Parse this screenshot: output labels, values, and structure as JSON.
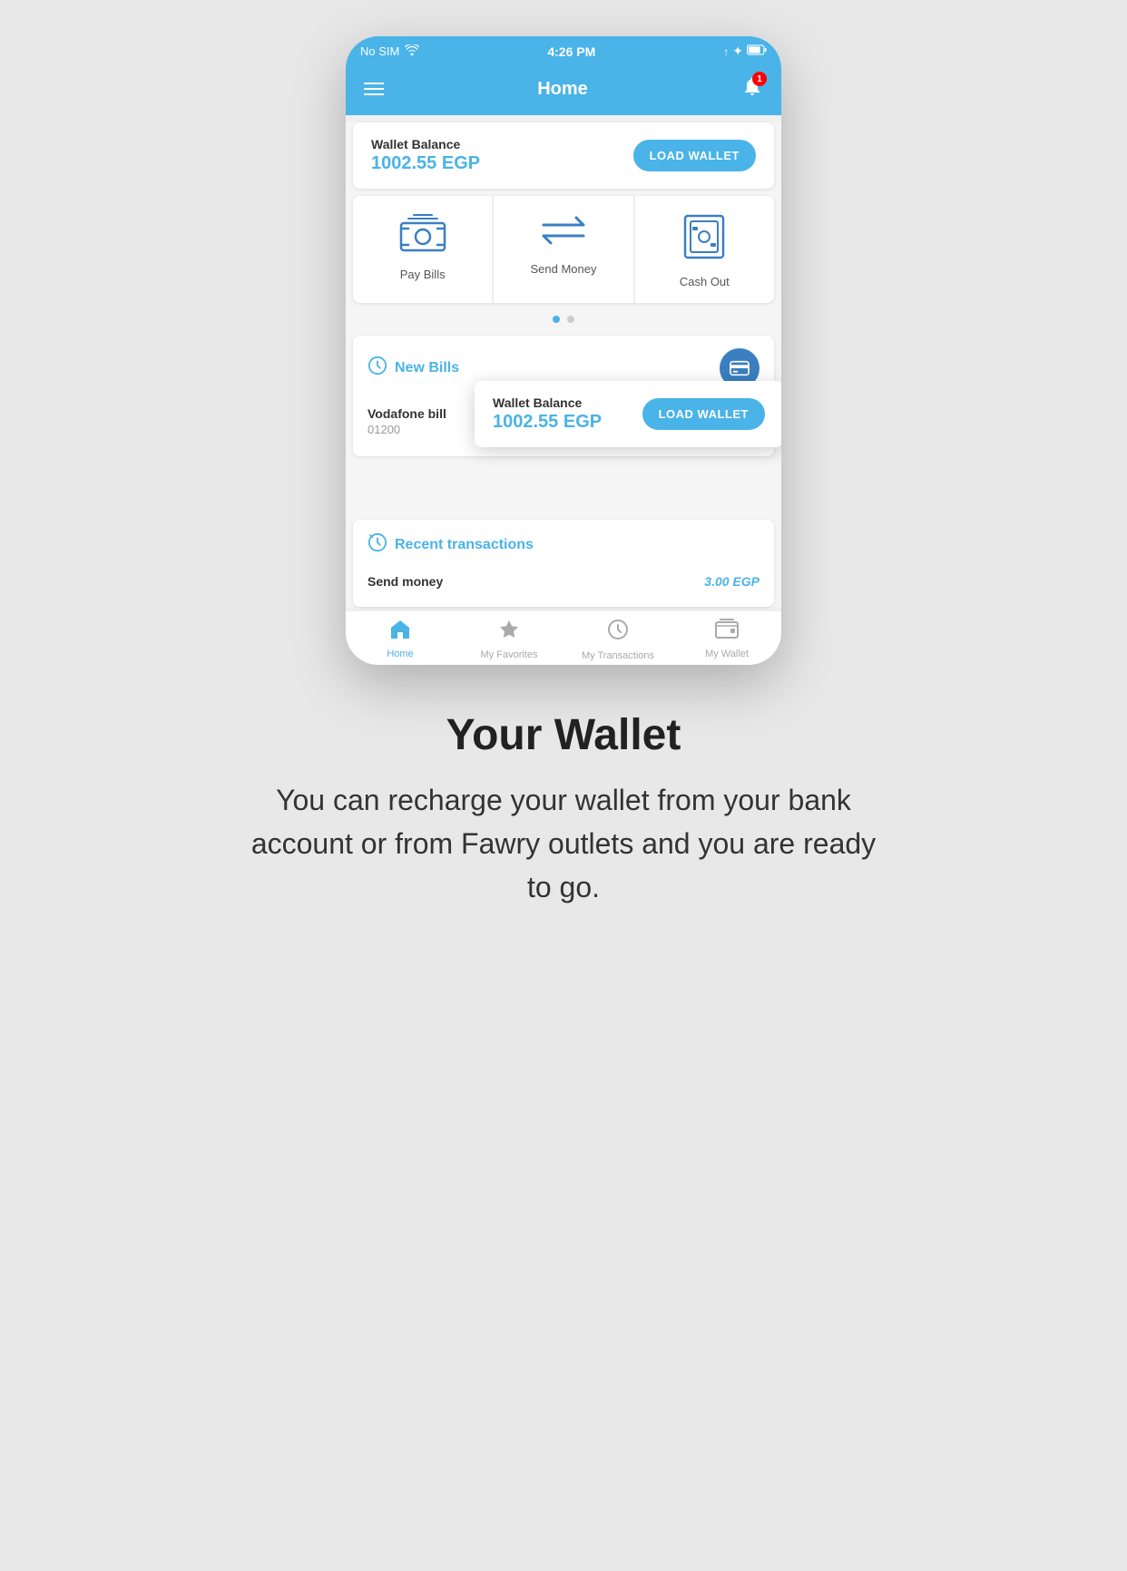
{
  "status_bar": {
    "carrier": "No SIM",
    "wifi_icon": "wifi",
    "time": "4:26 PM",
    "signal_icon": "signal",
    "bluetooth_icon": "bluetooth",
    "battery_icon": "battery"
  },
  "nav": {
    "title": "Home",
    "notification_count": "1"
  },
  "wallet": {
    "label": "Wallet Balance",
    "amount": "1002.55 EGP",
    "load_btn": "LOAD WALLET"
  },
  "quick_actions": [
    {
      "label": "Pay Bills",
      "icon": "pay-bills"
    },
    {
      "label": "Send Money",
      "icon": "send-money"
    },
    {
      "label": "Cash Out",
      "icon": "cash-out"
    }
  ],
  "new_bills": {
    "title": "New Bills",
    "bill_name": "Vodafone bill",
    "bill_provider": "Vodafone",
    "bill_number": "01200"
  },
  "floating_wallet": {
    "label": "Wallet Balance",
    "amount": "1002.55 EGP",
    "load_btn": "LOAD WALLET"
  },
  "recent_transactions": {
    "title": "Recent transactions",
    "items": [
      {
        "name": "Send money",
        "amount": "3.00 EGP"
      }
    ]
  },
  "bottom_nav": [
    {
      "label": "Home",
      "icon": "home",
      "active": true
    },
    {
      "label": "My Favorites",
      "icon": "star",
      "active": false
    },
    {
      "label": "My Transactions",
      "icon": "clock",
      "active": false
    },
    {
      "label": "My Wallet",
      "icon": "wallet",
      "active": false
    }
  ],
  "page": {
    "title": "Your Wallet",
    "description": "You can recharge your wallet from your bank account or from Fawry outlets and you are ready to go."
  }
}
